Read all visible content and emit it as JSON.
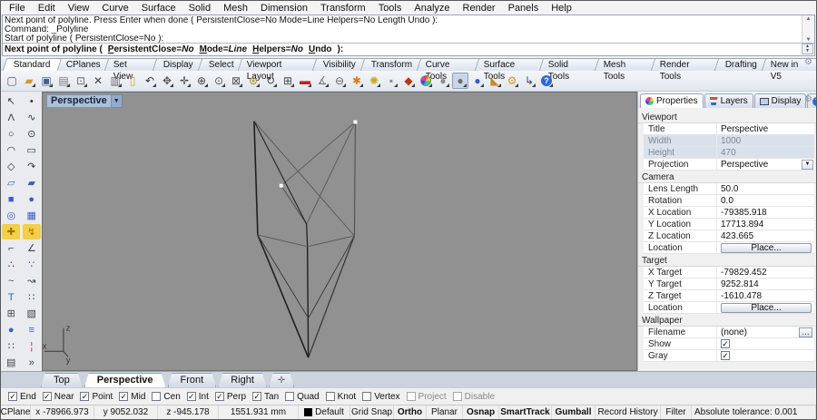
{
  "menu": {
    "items": [
      "File",
      "Edit",
      "View",
      "Curve",
      "Surface",
      "Solid",
      "Mesh",
      "Dimension",
      "Transform",
      "Tools",
      "Analyze",
      "Render",
      "Panels",
      "Help"
    ]
  },
  "command": {
    "history": [
      "Next point of polyline. Press Enter when done ( PersistentClose=No  Mode=Line  Helpers=No  Length  Undo ):",
      "Command: _Polyline",
      "Start of polyline ( PersistentClose=No ):"
    ],
    "prompt": {
      "prefix": "Next point of polyline",
      "open_paren": "(",
      "close": "):",
      "options": [
        {
          "hot": "P",
          "rest": "ersistentClose",
          "value": "No"
        },
        {
          "hot": "M",
          "rest": "ode",
          "value": "Line"
        },
        {
          "hot": "H",
          "rest": "elpers",
          "value": "No"
        },
        {
          "hot": "U",
          "rest": "ndo",
          "value": ""
        }
      ]
    }
  },
  "toolbar": {
    "tabs": [
      {
        "label": "Standard",
        "active": true
      },
      {
        "label": "CPlanes"
      },
      {
        "label": "Set View"
      },
      {
        "label": "Display"
      },
      {
        "label": "Select"
      },
      {
        "label": "Viewport Layout"
      },
      {
        "label": "Visibility"
      },
      {
        "label": "Transform"
      },
      {
        "label": "Curve Tools"
      },
      {
        "label": "Surface Tools"
      },
      {
        "label": "Solid Tools"
      },
      {
        "label": "Mesh Tools"
      },
      {
        "label": "Render Tools"
      },
      {
        "label": "Drafting"
      },
      {
        "label": "New in V5"
      }
    ],
    "icons": [
      {
        "name": "new-file-icon",
        "glyph": "▢",
        "color": "#5a5a5a",
        "flyout": false
      },
      {
        "name": "open-file-icon",
        "glyph": "▰",
        "color": "#d79b2a",
        "flyout": true
      },
      {
        "name": "save-icon",
        "glyph": "▣",
        "color": "#4a5f8a",
        "flyout": true
      },
      {
        "name": "print-icon",
        "glyph": "▤",
        "color": "#777777",
        "flyout": true
      },
      {
        "name": "export-icon",
        "glyph": "⊡",
        "color": "#666666",
        "flyout": true
      },
      {
        "name": "cut-icon",
        "glyph": "✕",
        "color": "#444444",
        "flyout": false
      },
      {
        "name": "copy-icon",
        "glyph": "▥",
        "color": "#666666",
        "flyout": true
      },
      {
        "name": "paste-icon",
        "glyph": "▯",
        "color": "#c7a53a",
        "flyout": false
      },
      {
        "name": "undo-icon",
        "glyph": "↶",
        "color": "#333333",
        "flyout": true
      },
      {
        "name": "pan-icon",
        "glyph": "✥",
        "color": "#555555",
        "flyout": true
      },
      {
        "name": "move-icon",
        "glyph": "✛",
        "color": "#444444",
        "flyout": true
      },
      {
        "name": "zoom-icon",
        "glyph": "⊕",
        "color": "#444444",
        "flyout": true
      },
      {
        "name": "zoom-dynamic-icon",
        "glyph": "⊙",
        "color": "#555555",
        "flyout": true
      },
      {
        "name": "zoom-window-icon",
        "glyph": "⊠",
        "color": "#555555",
        "flyout": true
      },
      {
        "name": "zoom-selected-icon",
        "glyph": "⊛",
        "color": "#b08a1a",
        "flyout": true
      },
      {
        "name": "rotate-view-icon",
        "glyph": "↻",
        "color": "#444444",
        "flyout": true
      },
      {
        "name": "viewport-layout-icon",
        "glyph": "⊞",
        "color": "#444444",
        "flyout": true
      },
      {
        "name": "shade-icon",
        "glyph": "▬",
        "color": "#c22222",
        "flyout": true
      },
      {
        "name": "measure-icon",
        "glyph": "∡",
        "color": "#777777",
        "flyout": true
      },
      {
        "name": "cplane-icon",
        "glyph": "⊖",
        "color": "#666666",
        "flyout": true
      },
      {
        "name": "block-icon",
        "glyph": "✱",
        "color": "#d97c1a",
        "flyout": true
      },
      {
        "name": "light-icon",
        "glyph": "✺",
        "color": "#c9a516",
        "flyout": true
      },
      {
        "name": "lock-icon",
        "glyph": "▪",
        "color": "#8a8a8a",
        "flyout": true
      },
      {
        "name": "layers-icon",
        "glyph": "◆",
        "color": "#c03311",
        "flyout": true
      },
      {
        "name": "colorwheel-icon",
        "glyph": "",
        "kind": "colorwheel",
        "flyout": true
      },
      {
        "name": "display-wireframe-icon",
        "glyph": "●",
        "color": "#8f8f8f",
        "flyout": true
      },
      {
        "name": "display-shaded-icon",
        "glyph": "●",
        "color": "#6f6f6f",
        "flyout": true,
        "pressed": true
      },
      {
        "name": "render-icon",
        "glyph": "●",
        "color": "#2b5fd9",
        "flyout": true
      },
      {
        "name": "render-preview-icon",
        "glyph": "◣",
        "color": "#cc8822",
        "flyout": true
      },
      {
        "name": "options-icon",
        "glyph": "⚙",
        "color": "#c9a21a",
        "flyout": true
      },
      {
        "name": "history-icon",
        "glyph": "↳",
        "color": "#444444",
        "flyout": true
      },
      {
        "name": "help-icon",
        "glyph": "?",
        "kind": "help",
        "flyout": true
      }
    ]
  },
  "sidebar": {
    "icons": [
      {
        "name": "pointer-icon",
        "glyph": "↖",
        "color": "#333333"
      },
      {
        "name": "point-icon",
        "glyph": "•",
        "color": "#333333"
      },
      {
        "name": "polyline-icon",
        "glyph": "Λ",
        "color": "#333333"
      },
      {
        "name": "curve-icon",
        "glyph": "∿",
        "color": "#333333"
      },
      {
        "name": "circle-icon",
        "glyph": "○",
        "color": "#333333"
      },
      {
        "name": "ellipse-icon",
        "glyph": "⊙",
        "color": "#333333"
      },
      {
        "name": "arc-icon",
        "glyph": "◠",
        "color": "#333333"
      },
      {
        "name": "rectangle-icon",
        "glyph": "▭",
        "color": "#333333"
      },
      {
        "name": "polygon-icon",
        "glyph": "◇",
        "color": "#333333"
      },
      {
        "name": "curve-blend-icon",
        "glyph": "↷",
        "color": "#333333"
      },
      {
        "name": "surface-points-icon",
        "glyph": "▱",
        "color": "#3c5fc0"
      },
      {
        "name": "surface-sweep-icon",
        "glyph": "▰",
        "color": "#3c5fc0"
      },
      {
        "name": "box-icon",
        "glyph": "■",
        "color": "#3c5fc0"
      },
      {
        "name": "sphere-icon",
        "glyph": "●",
        "color": "#3c5fc0"
      },
      {
        "name": "torus-icon",
        "glyph": "◎",
        "color": "#3c5fc0"
      },
      {
        "name": "mesh-box-icon",
        "glyph": "▦",
        "color": "#3c5fc0"
      },
      {
        "name": "boolean-icon",
        "glyph": "✚",
        "color": "#9a7400",
        "bg": "#f3cf4a"
      },
      {
        "name": "explode-icon",
        "glyph": "↯",
        "color": "#b56a00",
        "bg": "#f3cf4a"
      },
      {
        "name": "fillet-icon",
        "glyph": "⌐",
        "color": "#444444"
      },
      {
        "name": "chamfer-icon",
        "glyph": "∠",
        "color": "#444444"
      },
      {
        "name": "curve-boolean-icon",
        "glyph": "∴",
        "color": "#7a2020"
      },
      {
        "name": "point-cloud-icon",
        "glyph": "∵",
        "color": "#6a4a9a"
      },
      {
        "name": "rebuild-curve-icon",
        "glyph": "~",
        "color": "#444444"
      },
      {
        "name": "extend-curve-icon",
        "glyph": "↝",
        "color": "#444444"
      },
      {
        "name": "text-icon",
        "glyph": "T",
        "color": "#2a6aa0"
      },
      {
        "name": "points-on-icon",
        "glyph": "∷",
        "color": "#444444"
      },
      {
        "name": "block-define-icon",
        "glyph": "⊞",
        "color": "#444444"
      },
      {
        "name": "hatch-icon",
        "glyph": "▧",
        "color": "#444444"
      },
      {
        "name": "solid-union-icon",
        "glyph": "●",
        "color": "#3c5fc0"
      },
      {
        "name": "extrude-icon",
        "glyph": "≡",
        "color": "#3c5fc0"
      },
      {
        "name": "array-icon",
        "glyph": "∷",
        "color": "#444444"
      },
      {
        "name": "section-icon",
        "glyph": "¦",
        "color": "#c03030"
      },
      {
        "name": "named-view-icon",
        "glyph": "▤",
        "color": "#444444"
      },
      {
        "name": "more-tools-icon",
        "glyph": "»",
        "color": "#444444"
      }
    ]
  },
  "viewport": {
    "title": "Perspective",
    "dropdown_glyph": "▼",
    "axis": {
      "x": "x",
      "y": "y",
      "z": "z"
    },
    "points": {
      "A": [
        234,
        32
      ],
      "B": [
        346,
        33
      ],
      "C": [
        264,
        104
      ],
      "D": [
        292,
        147
      ],
      "E": [
        293,
        172
      ],
      "F": [
        238,
        159
      ],
      "G": [
        345,
        160
      ],
      "H": [
        294,
        252
      ],
      "I": [
        294,
        296
      ]
    },
    "edges": [
      [
        "A",
        "F",
        1.6,
        "#1f1f1f"
      ],
      [
        "F",
        "I",
        1.6,
        "#1f1f1f"
      ],
      [
        "B",
        "G",
        1.0,
        "#4a4a4a"
      ],
      [
        "G",
        "I",
        1.2,
        "#333333"
      ],
      [
        "A",
        "G",
        0.9,
        "#575757"
      ],
      [
        "B",
        "C",
        0.9,
        "#575757"
      ],
      [
        "C",
        "D",
        0.9,
        "#4a4a4a"
      ],
      [
        "B",
        "D",
        0.9,
        "#575757"
      ],
      [
        "A",
        "D",
        1.2,
        "#2a2a2a"
      ],
      [
        "D",
        "E",
        1.3,
        "#232323"
      ],
      [
        "E",
        "I",
        1.4,
        "#1f1f1f"
      ],
      [
        "F",
        "H",
        1.0,
        "#3d3d3d"
      ],
      [
        "G",
        "H",
        1.0,
        "#3d3d3d"
      ],
      [
        "E",
        "F",
        0.9,
        "#575757"
      ],
      [
        "E",
        "G",
        0.9,
        "#575757"
      ]
    ],
    "white_points": [
      [
        346,
        33
      ],
      [
        264,
        104
      ]
    ]
  },
  "panel": {
    "tabs": [
      {
        "label": "Properties",
        "icon": "colorwheel",
        "active": true
      },
      {
        "label": "Layers",
        "icon": "layers"
      },
      {
        "label": "Display",
        "icon": "display"
      },
      {
        "label": "Help",
        "icon": "help"
      }
    ],
    "sections": [
      {
        "title": "Viewport",
        "rows": [
          {
            "label": "Title",
            "value": "Perspective",
            "type": "text"
          },
          {
            "label": "Width",
            "value": "1000",
            "type": "disabled"
          },
          {
            "label": "Height",
            "value": "470",
            "type": "disabled"
          },
          {
            "label": "Projection",
            "value": "Perspective",
            "type": "dropdown"
          }
        ]
      },
      {
        "title": "Camera",
        "rows": [
          {
            "label": "Lens Length",
            "value": "50.0",
            "type": "text"
          },
          {
            "label": "Rotation",
            "value": "0.0",
            "type": "text"
          },
          {
            "label": "X Location",
            "value": "-79385.918",
            "type": "text"
          },
          {
            "label": "Y Location",
            "value": "17713.894",
            "type": "text"
          },
          {
            "label": "Z Location",
            "value": "423.665",
            "type": "text"
          },
          {
            "label": "Location",
            "value": "Place...",
            "type": "button"
          }
        ]
      },
      {
        "title": "Target",
        "rows": [
          {
            "label": "X Target",
            "value": "-79829.452",
            "type": "text"
          },
          {
            "label": "Y Target",
            "value": "9252.814",
            "type": "text"
          },
          {
            "label": "Z Target",
            "value": "-1610.478",
            "type": "text"
          },
          {
            "label": "Location",
            "value": "Place...",
            "type": "button"
          }
        ]
      },
      {
        "title": "Wallpaper",
        "rows": [
          {
            "label": "Filename",
            "value": "(none)",
            "type": "file",
            "button": "..."
          },
          {
            "label": "Show",
            "checked": true,
            "type": "check"
          },
          {
            "label": "Gray",
            "checked": true,
            "type": "check"
          }
        ]
      }
    ]
  },
  "viewport_tabs": {
    "tabs": [
      {
        "label": "Top"
      },
      {
        "label": "Perspective",
        "active": true
      },
      {
        "label": "Front"
      },
      {
        "label": "Right"
      }
    ],
    "new_tab_label": "✛"
  },
  "osnap": {
    "items": [
      {
        "label": "End",
        "checked": true
      },
      {
        "label": "Near",
        "checked": true
      },
      {
        "label": "Point",
        "checked": true
      },
      {
        "label": "Mid",
        "checked": true
      },
      {
        "label": "Cen",
        "checked": false
      },
      {
        "label": "Int",
        "checked": true
      },
      {
        "label": "Perp",
        "checked": true
      },
      {
        "label": "Tan",
        "checked": true
      },
      {
        "label": "Quad",
        "checked": false
      },
      {
        "label": "Knot",
        "checked": false
      },
      {
        "label": "Vertex",
        "checked": false
      },
      {
        "label": "Project",
        "checked": false,
        "dim": true
      },
      {
        "label": "Disable",
        "checked": false,
        "dim": true
      }
    ]
  },
  "statusbar": {
    "cells": [
      {
        "label": "CPlane",
        "interactable": true
      },
      {
        "label": "x -78966.973"
      },
      {
        "label": "y 9052.032"
      },
      {
        "label": "z -945.178"
      },
      {
        "label": "1551.931 mm"
      },
      {
        "label": "Default",
        "swatch": "#000000",
        "interactable": true
      },
      {
        "label": "Grid Snap",
        "interactable": true
      },
      {
        "label": "Ortho",
        "bold": true,
        "interactable": true
      },
      {
        "label": "Planar",
        "interactable": true
      },
      {
        "label": "Osnap",
        "bold": true,
        "interactable": true
      },
      {
        "label": "SmartTrack",
        "bold": true,
        "interactable": true
      },
      {
        "label": "Gumball",
        "bold": true,
        "interactable": true
      },
      {
        "label": "Record History",
        "interactable": true
      },
      {
        "label": "Filter",
        "interactable": true
      },
      {
        "label": "Absolute tolerance: 0.001"
      }
    ]
  }
}
